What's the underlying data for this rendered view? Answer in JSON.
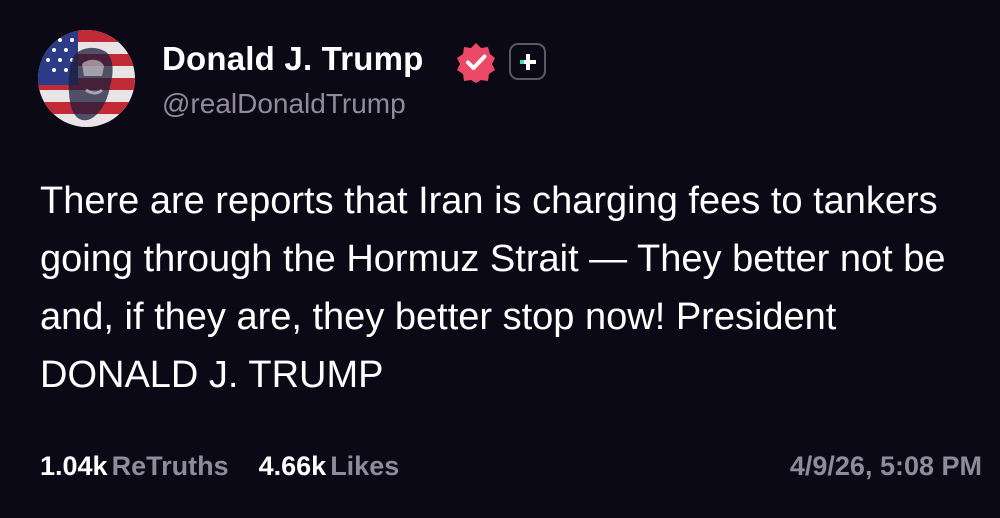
{
  "author": {
    "display_name": "Donald J. Trump",
    "handle": "@realDonaldTrump",
    "avatar_icon": "flag-portrait-avatar",
    "verified_icon": "verified-badge-icon",
    "verified_color": "#ec4868",
    "plus_icon": "plus-subscription-icon"
  },
  "post": {
    "text": "There are reports that Iran is charging fees to tankers going through the Hormuz Strait — They better not be and, if they are, they better stop now! President DONALD J. TRUMP"
  },
  "stats": {
    "retruths_count": "1.04k",
    "retruths_label": "ReTruths",
    "likes_count": "4.66k",
    "likes_label": "Likes"
  },
  "timestamp": "4/9/26, 5:08 PM",
  "colors": {
    "background": "#0c0916",
    "muted_text": "#8f8b9c",
    "plus_accent": "#3ee0c0"
  }
}
